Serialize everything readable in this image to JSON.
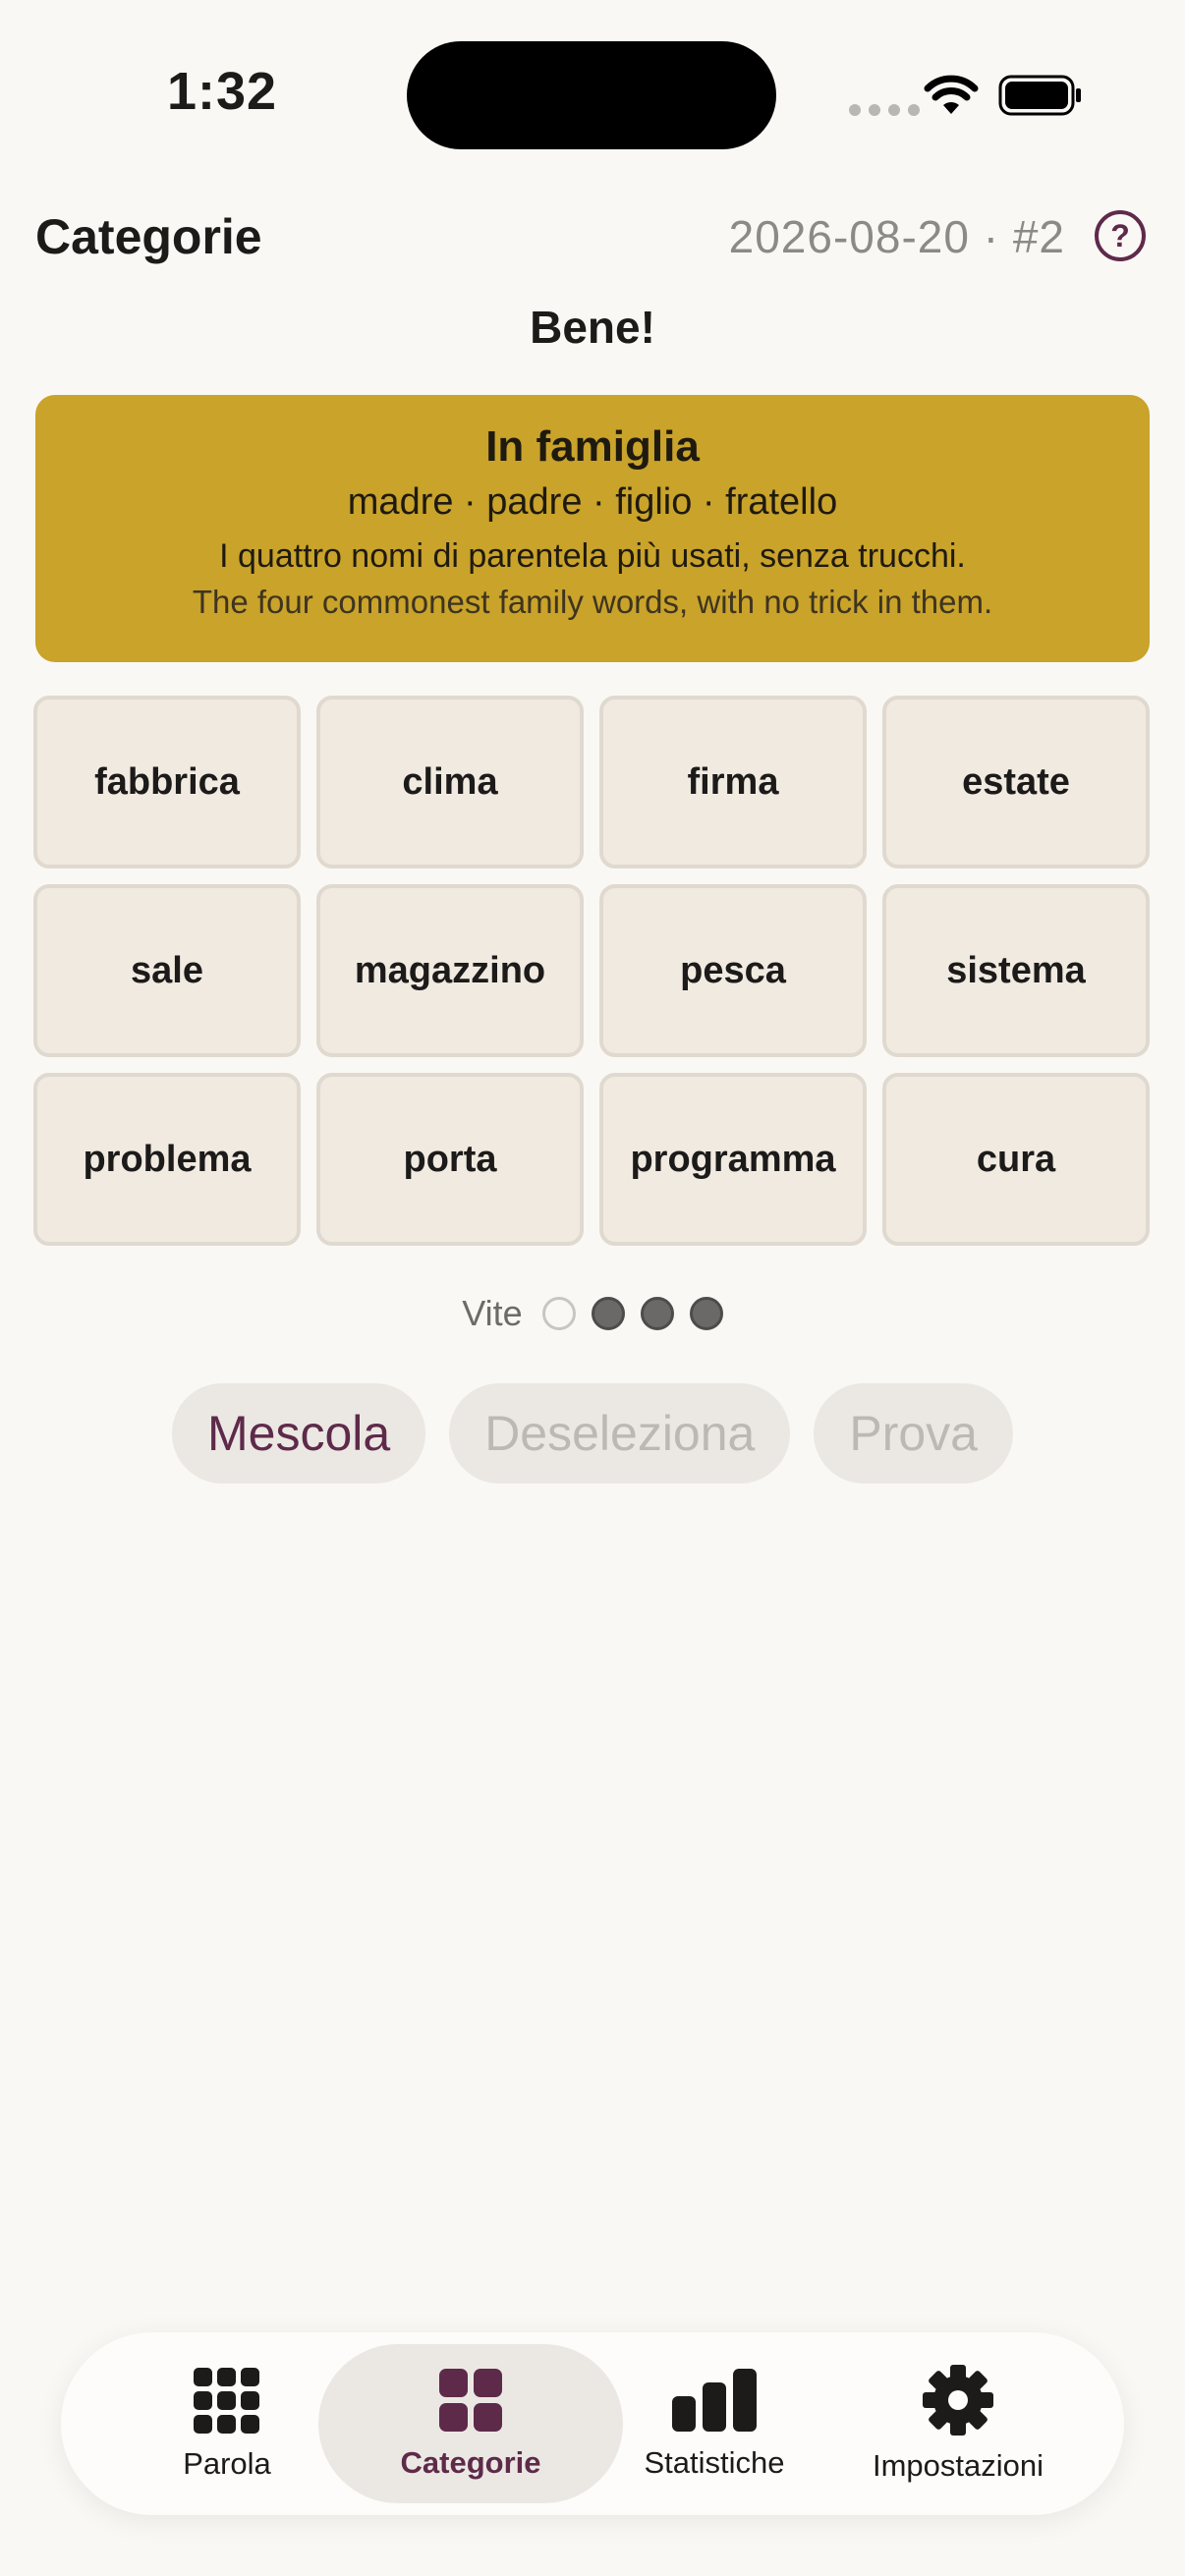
{
  "status_bar": {
    "time": "1:32"
  },
  "header": {
    "title": "Categorie",
    "puzzle_id": "2026-08-20 · #2",
    "help_icon": "question-mark-icon",
    "help_glyph": "?"
  },
  "feedback": "Bene!",
  "solved_group": {
    "title": "In famiglia",
    "words": "madre · padre · figlio · fratello",
    "description_it": "I quattro nomi di parentela più usati, senza trucchi.",
    "description_en": "The four commonest family words, with no trick in them.",
    "color": "#c9a32a"
  },
  "tiles": [
    "fabbrica",
    "clima",
    "firma",
    "estate",
    "sale",
    "magazzino",
    "pesca",
    "sistema",
    "problema",
    "porta",
    "programma",
    "cura"
  ],
  "lives": {
    "label": "Vite",
    "total": 4,
    "remaining": 3
  },
  "actions": {
    "shuffle": "Mescola",
    "deselect": "Deseleziona",
    "submit": "Prova"
  },
  "tabs": [
    {
      "label": "Parola",
      "icon": "grid-dots-icon",
      "active": false
    },
    {
      "label": "Categorie",
      "icon": "four-squares-icon",
      "active": true
    },
    {
      "label": "Statistiche",
      "icon": "bar-chart-icon",
      "active": false
    },
    {
      "label": "Impostazioni",
      "icon": "gear-icon",
      "active": false
    }
  ],
  "colors": {
    "accent": "#5e2a4a",
    "background": "#faf8f4",
    "tile": "#f0eae1"
  }
}
